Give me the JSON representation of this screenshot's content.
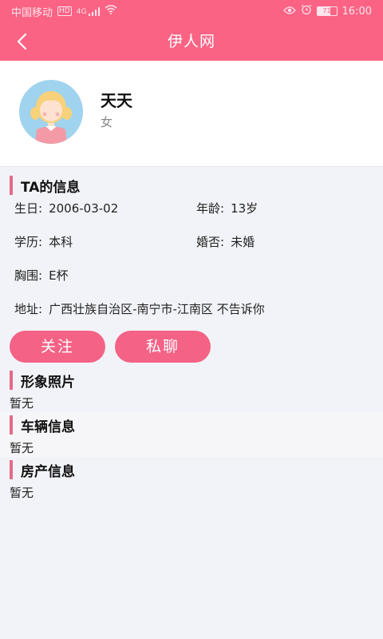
{
  "status_bar": {
    "carrier": "中国移动",
    "hd": "HD",
    "signal": "4G",
    "battery": "71",
    "time": "16:00"
  },
  "navbar": {
    "title": "伊人网"
  },
  "profile": {
    "name": "天天",
    "gender": "女"
  },
  "ta_info": {
    "title": "TA的信息",
    "birthday_label": "生日:",
    "birthday": "2006-03-02",
    "age_label": "年龄:",
    "age": "13岁",
    "education_label": "学历:",
    "education": "本科",
    "marital_label": "婚否:",
    "marital": "未婚",
    "bust_label": "胸围:",
    "bust": "E杯",
    "address_label": "地址:",
    "address": "广西壮族自治区-南宁市-江南区 不告诉你"
  },
  "actions": {
    "follow": "关注",
    "chat": "私聊"
  },
  "photos": {
    "title": "形象照片",
    "value": "暂无"
  },
  "vehicle": {
    "title": "车辆信息",
    "value": "暂无"
  },
  "property": {
    "title": "房产信息",
    "value": "暂无"
  },
  "colors": {
    "brand": "#fb6385",
    "button": "#f46286",
    "section_bar": "#e46a8a"
  }
}
